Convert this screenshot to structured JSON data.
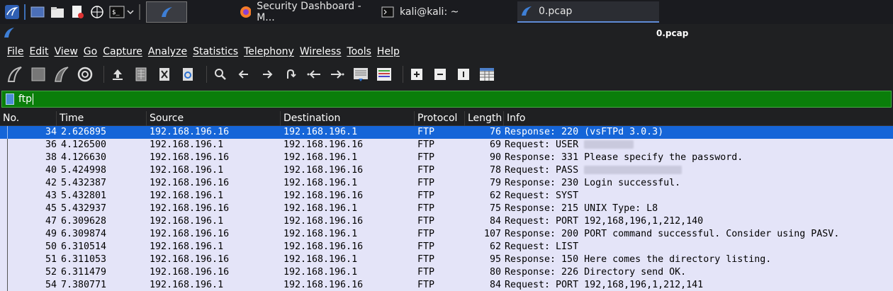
{
  "taskbar": {
    "tasks": [
      {
        "label": "Security Dashboard - M..."
      },
      {
        "label": "kali@kali: ~"
      },
      {
        "label": "0.pcap"
      }
    ]
  },
  "window": {
    "title": "0.pcap"
  },
  "menu": [
    "File",
    "Edit",
    "View",
    "Go",
    "Capture",
    "Analyze",
    "Statistics",
    "Telephony",
    "Wireless",
    "Tools",
    "Help"
  ],
  "filter": {
    "value": "ftp"
  },
  "columns": [
    "No.",
    "Time",
    "Source",
    "Destination",
    "Protocol",
    "Length",
    "Info"
  ],
  "packets": [
    {
      "no": "34",
      "time": "2.626895",
      "src": "192.168.196.16",
      "dst": "192.168.196.1",
      "proto": "FTP",
      "len": "76",
      "info": "Response: 220 (vsFTPd 3.0.3)"
    },
    {
      "no": "36",
      "time": "4.126500",
      "src": "192.168.196.1",
      "dst": "192.168.196.16",
      "proto": "FTP",
      "len": "69",
      "info": "Request: USER",
      "redacted": "short"
    },
    {
      "no": "38",
      "time": "4.126630",
      "src": "192.168.196.16",
      "dst": "192.168.196.1",
      "proto": "FTP",
      "len": "90",
      "info": "Response: 331 Please specify the password."
    },
    {
      "no": "40",
      "time": "5.424998",
      "src": "192.168.196.1",
      "dst": "192.168.196.16",
      "proto": "FTP",
      "len": "78",
      "info": "Request: PASS",
      "redacted": "long"
    },
    {
      "no": "42",
      "time": "5.432387",
      "src": "192.168.196.16",
      "dst": "192.168.196.1",
      "proto": "FTP",
      "len": "79",
      "info": "Response: 230 Login successful."
    },
    {
      "no": "43",
      "time": "5.432801",
      "src": "192.168.196.1",
      "dst": "192.168.196.16",
      "proto": "FTP",
      "len": "62",
      "info": "Request: SYST"
    },
    {
      "no": "45",
      "time": "5.432937",
      "src": "192.168.196.16",
      "dst": "192.168.196.1",
      "proto": "FTP",
      "len": "75",
      "info": "Response: 215 UNIX Type: L8"
    },
    {
      "no": "47",
      "time": "6.309628",
      "src": "192.168.196.1",
      "dst": "192.168.196.16",
      "proto": "FTP",
      "len": "84",
      "info": "Request: PORT 192,168,196,1,212,140"
    },
    {
      "no": "49",
      "time": "6.309874",
      "src": "192.168.196.16",
      "dst": "192.168.196.1",
      "proto": "FTP",
      "len": "107",
      "info": "Response: 200 PORT command successful. Consider using PASV."
    },
    {
      "no": "50",
      "time": "6.310514",
      "src": "192.168.196.1",
      "dst": "192.168.196.16",
      "proto": "FTP",
      "len": "62",
      "info": "Request: LIST"
    },
    {
      "no": "51",
      "time": "6.311053",
      "src": "192.168.196.16",
      "dst": "192.168.196.1",
      "proto": "FTP",
      "len": "95",
      "info": "Response: 150 Here comes the directory listing."
    },
    {
      "no": "52",
      "time": "6.311479",
      "src": "192.168.196.16",
      "dst": "192.168.196.1",
      "proto": "FTP",
      "len": "80",
      "info": "Response: 226 Directory send OK."
    },
    {
      "no": "54",
      "time": "7.380771",
      "src": "192.168.196.1",
      "dst": "192.168.196.16",
      "proto": "FTP",
      "len": "84",
      "info": "Request: PORT 192,168,196,1,212,141"
    }
  ],
  "selected_row": 0,
  "colors": {
    "row_bg": "#e4e4f8",
    "selected_bg": "#1565d8",
    "filter_bg": "#0a7e0a"
  }
}
